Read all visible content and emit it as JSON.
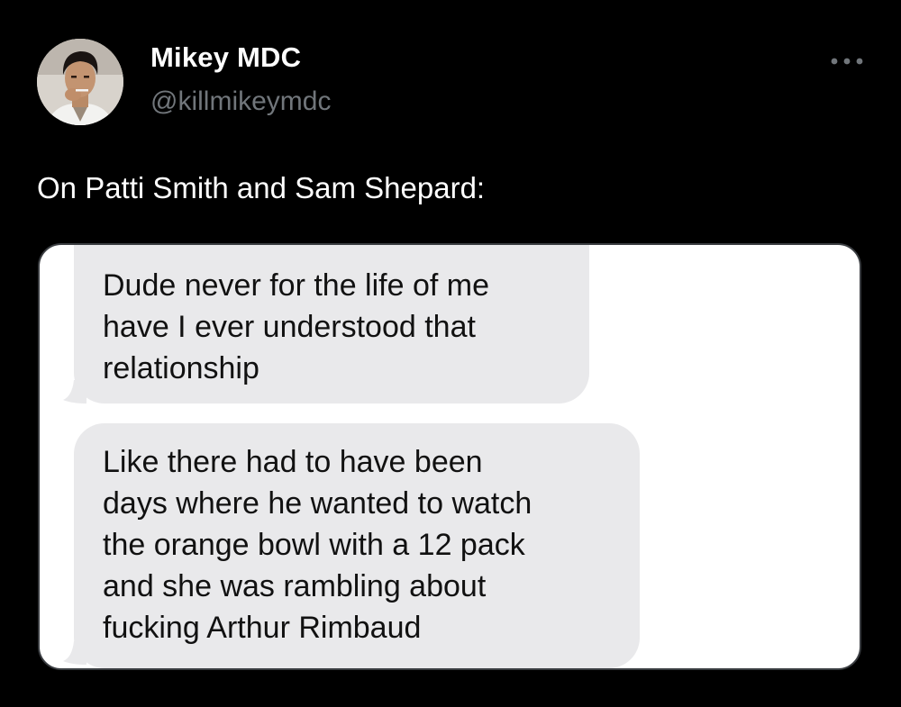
{
  "author": {
    "display_name": "Mikey MDC",
    "handle": "@killmikeymdc",
    "avatar": "profile-photo"
  },
  "more_icon": "ellipsis-icon",
  "tweet": {
    "text": "On Patti Smith and Sam Shepard:"
  },
  "media": {
    "type": "text-message-screenshot",
    "messages": [
      {
        "lines": [
          "Dude never for the life of me",
          "have I ever understood that",
          "relationship"
        ]
      },
      {
        "lines": [
          "Like there had to have been",
          "days where he wanted to watch",
          "the orange bowl with a 12 pack",
          "and she was rambling about",
          "fucking Arthur Rimbaud"
        ]
      }
    ]
  },
  "colors": {
    "background": "#000000",
    "secondary_text": "#71767b",
    "bubble": "#e9e9eb"
  }
}
